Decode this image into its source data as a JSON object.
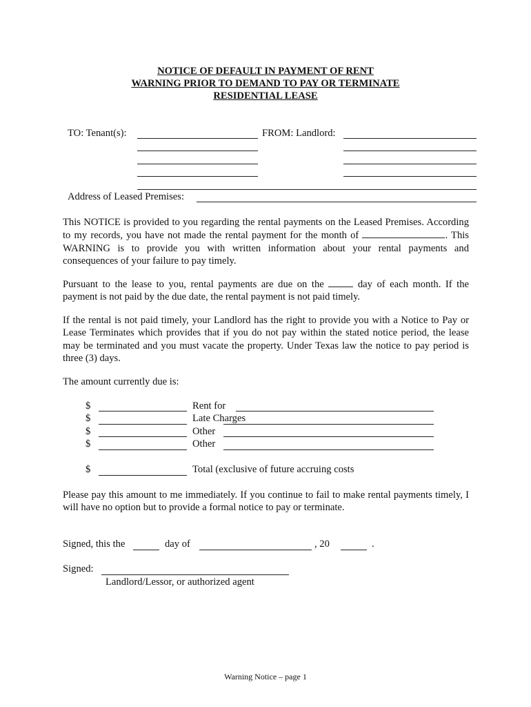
{
  "title": {
    "line1": "NOTICE OF DEFAULT IN PAYMENT OF RENT",
    "line2": "WARNING PRIOR TO DEMAND TO PAY OR TERMINATE",
    "line3": "RESIDENTIAL LEASE"
  },
  "parties": {
    "to_label": "TO: Tenant(s):",
    "from_label": "FROM: Landlord:",
    "address_label": "Address of Leased Premises:"
  },
  "paragraphs": {
    "notice_a": "This NOTICE is provided to you regarding the rental payments on the Leased Premises. According to my records, you have not made the rental payment for the month of",
    "notice_b": ".  This WARNING is to provide you with written information about your rental payments and consequences of your failure to pay timely.",
    "pursuant_a": "Pursuant to the lease to you, rental payments are due on the",
    "pursuant_b": "day of each month.  If the payment is not paid by the due date, the rental payment is not paid timely.",
    "rights": "If the rental is not paid timely, your Landlord has the right to provide you with a Notice to Pay or Lease Terminates which provides that if you do not pay within the stated notice period, the lease may be terminated and you must vacate the property.  Under Texas law the notice to pay period is three (3) days.",
    "amount_due": "The amount currently due is:",
    "please_pay": "Please pay this amount to me immediately.  If you continue to fail to make rental payments timely, I will have no option but to provide a formal notice to pay or terminate."
  },
  "charges": {
    "currency": "$",
    "rows": [
      {
        "label": "Rent for"
      },
      {
        "label": "Late Charges"
      },
      {
        "label": "Other"
      },
      {
        "label": "Other"
      }
    ],
    "total_label": "Total (exclusive of future accruing costs"
  },
  "signature": {
    "signed_this": "Signed, this the",
    "day_of": "day of",
    "year_prefix": ", 20",
    "period": ".",
    "signed_label": "Signed:",
    "signer_caption": "Landlord/Lessor, or authorized agent"
  },
  "footer": {
    "page_label": "Warning Notice – page 1"
  }
}
